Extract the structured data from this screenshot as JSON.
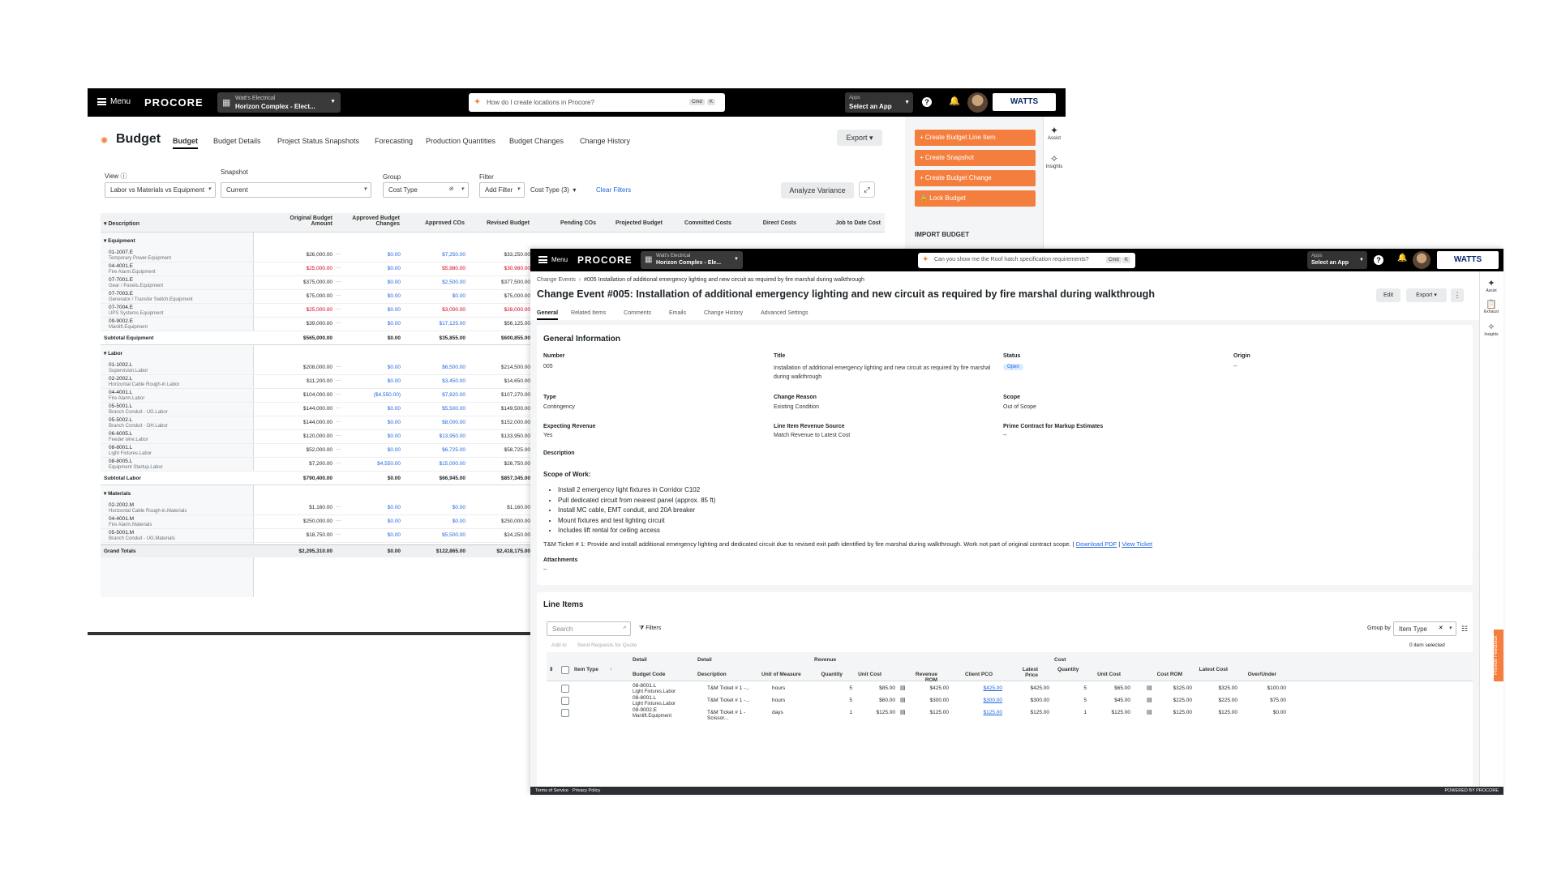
{
  "budget_window": {
    "topbar": {
      "menu_label": "Menu",
      "logo": "PROCORE",
      "project_company": "Watt's Electrical",
      "project_name": "Horizon Complex - Elect...",
      "search_placeholder": "How do I create locations in Procore?",
      "kbd_cmd": "Cmd",
      "kbd_k": "K",
      "apps_small": "Apps",
      "apps_main": "Select an App",
      "brand": "WATTS"
    },
    "page_title": "Budget",
    "tabs": [
      "Budget",
      "Budget Details",
      "Project Status Snapshots",
      "Forecasting",
      "Production Quantities",
      "Budget Changes",
      "Change History"
    ],
    "export_label": "Export",
    "view_label": "View",
    "view_value": "Labor vs Materials vs Equipment",
    "snapshot_label": "Snapshot",
    "snapshot_value": "Current",
    "group_label": "Group",
    "group_value": "Cost Type",
    "filter_label": "Filter",
    "filter_value": "Add Filter",
    "cost_type_filter": "Cost Type (3)",
    "clear_filters": "Clear Filters",
    "analyze_label": "Analyze Variance",
    "columns": [
      "Description",
      "Original Budget Amount",
      "Approved Budget Changes",
      "Approved COs",
      "Revised Budget",
      "Pending COs",
      "Projected Budget",
      "Committed Costs",
      "Direct Costs",
      "Job to Date Cost"
    ],
    "groups": [
      {
        "name": "Equipment",
        "rows": [
          {
            "code": "01-1007.E",
            "sub": "Temporary Power.Equipment",
            "orig": "$26,000.00",
            "abc": "$0.00",
            "aco": "$7,250.00",
            "rev": "$33,250.00",
            "neg": false
          },
          {
            "code": "04-4001.E",
            "sub": "Fire Alarm.Equipment",
            "orig": "$25,000.00",
            "abc": "$0.00",
            "aco": "$5,980.00",
            "rev": "$30,980.00",
            "neg": true
          },
          {
            "code": "07-7001.E",
            "sub": "Gear / Panels.Equipment",
            "orig": "$375,000.00",
            "abc": "$0.00",
            "aco": "$2,500.00",
            "rev": "$377,500.00",
            "neg": false
          },
          {
            "code": "07-7003.E",
            "sub": "Generator / Transfer Switch.Equipment",
            "orig": "$75,000.00",
            "abc": "$0.00",
            "aco": "$0.00",
            "rev": "$75,000.00",
            "neg": false
          },
          {
            "code": "07-7004.E",
            "sub": "UPS Systems.Equipment",
            "orig": "$25,000.00",
            "abc": "$0.00",
            "aco": "$3,000.00",
            "rev": "$28,000.00",
            "neg": true
          },
          {
            "code": "09-9002.E",
            "sub": "Manlift.Equipment",
            "orig": "$39,000.00",
            "abc": "$0.00",
            "aco": "$17,125.00",
            "rev": "$56,125.00",
            "neg": false
          }
        ],
        "subtotal": {
          "label": "Subtotal Equipment",
          "orig": "$565,000.00",
          "abc": "$0.00",
          "aco": "$35,855.00",
          "rev": "$600,855.00"
        }
      },
      {
        "name": "Labor",
        "rows": [
          {
            "code": "01-1002.L",
            "sub": "Supervision.Labor",
            "orig": "$208,000.00",
            "abc": "$0.00",
            "aco": "$6,500.00",
            "rev": "$214,500.00",
            "neg": false
          },
          {
            "code": "02-2002.L",
            "sub": "Horizontal Cable Rough-in.Labor",
            "orig": "$11,200.00",
            "abc": "$0.00",
            "aco": "$3,450.00",
            "rev": "$14,650.00",
            "neg": false
          },
          {
            "code": "04-4001.L",
            "sub": "Fire Alarm.Labor",
            "orig": "$104,000.00",
            "abc": "($4,550.00)",
            "aco": "$7,820.00",
            "rev": "$107,270.00",
            "neg": false
          },
          {
            "code": "05-5001.L",
            "sub": "Branch Conduit - UG.Labor",
            "orig": "$144,000.00",
            "abc": "$0.00",
            "aco": "$5,500.00",
            "rev": "$149,500.00",
            "neg": false
          },
          {
            "code": "05-5002.L",
            "sub": "Branch Conduit - OH.Labor",
            "orig": "$144,000.00",
            "abc": "$0.00",
            "aco": "$8,000.00",
            "rev": "$152,000.00",
            "neg": false
          },
          {
            "code": "06-6005.L",
            "sub": "Feeder wire.Labor",
            "orig": "$120,000.00",
            "abc": "$0.00",
            "aco": "$13,950.00",
            "rev": "$133,950.00",
            "neg": false
          },
          {
            "code": "08-8001.L",
            "sub": "Light Fixtures.Labor",
            "orig": "$52,000.00",
            "abc": "$0.00",
            "aco": "$6,725.00",
            "rev": "$58,725.00",
            "neg": false
          },
          {
            "code": "08-8005.L",
            "sub": "Equipment Startup.Labor",
            "orig": "$7,200.00",
            "abc": "$4,550.00",
            "aco": "$15,000.00",
            "rev": "$26,750.00",
            "neg": false
          }
        ],
        "subtotal": {
          "label": "Subtotal Labor",
          "orig": "$790,400.00",
          "abc": "$0.00",
          "aco": "$66,945.00",
          "rev": "$857,345.00"
        }
      },
      {
        "name": "Materials",
        "rows": [
          {
            "code": "02-2002.M",
            "sub": "Horizontal Cable Rough-in.Materials",
            "orig": "$1,160.00",
            "abc": "$0.00",
            "aco": "$0.00",
            "rev": "$1,160.00",
            "neg": false
          },
          {
            "code": "04-4001.M",
            "sub": "Fire Alarm.Materials",
            "orig": "$250,000.00",
            "abc": "$0.00",
            "aco": "$0.00",
            "rev": "$250,000.00",
            "neg": false
          },
          {
            "code": "05-5001.M",
            "sub": "Branch Conduit - UG.Materials",
            "orig": "$18,750.00",
            "abc": "$0.00",
            "aco": "$5,500.00",
            "rev": "$24,250.00",
            "neg": false
          }
        ]
      }
    ],
    "grand_totals": {
      "label": "Grand Totals",
      "orig": "$2,295,310.00",
      "abc": "$0.00",
      "aco": "$122,865.00",
      "rev": "$2,418,175.00"
    },
    "actions": [
      "Create Budget Line Item",
      "Create Snapshot",
      "Create Budget Change",
      "Lock Budget"
    ],
    "import_budget": "IMPORT BUDGET",
    "side_assist": "Assist",
    "side_insights": "Insights"
  },
  "change_event_window": {
    "topbar": {
      "menu_label": "Menu",
      "logo": "PROCORE",
      "project_company": "Watt's Electrical",
      "project_name": "Horizon Complex - Ele...",
      "search_placeholder": "Can you show me the Roof hatch specification requirements?",
      "kbd_cmd": "Cmd",
      "kbd_k": "K",
      "apps_small": "Apps",
      "apps_main": "Select an App",
      "brand": "WATTS"
    },
    "breadcrumb_root": "Change Events",
    "breadcrumb_current": "#005 Installation of additional emergency lighting and new circuit as required by fire marshal during walkthrough",
    "title": "Change Event #005: Installation of additional emergency lighting and new circuit as required by fire marshal during walkthrough",
    "edit_label": "Edit",
    "export_label": "Export",
    "tabs": [
      "General",
      "Related Items",
      "Comments",
      "Emails",
      "Change History",
      "Advanced Settings"
    ],
    "general_heading": "General Information",
    "fields": {
      "number_label": "Number",
      "number": "005",
      "title_label": "Title",
      "title": "Installation of additional emergency lighting and new circuit as required by fire marshal during walkthrough",
      "status_label": "Status",
      "status": "Open",
      "origin_label": "Origin",
      "origin": "--",
      "type_label": "Type",
      "type": "Contingency",
      "reason_label": "Change Reason",
      "reason": "Existing Condition",
      "scope_label": "Scope",
      "scope": "Out of Scope",
      "exp_rev_label": "Expecting Revenue",
      "exp_rev": "Yes",
      "rev_source_label": "Line Item Revenue Source",
      "rev_source": "Match Revenue to Latest Cost",
      "prime_label": "Prime Contract for Markup Estimates",
      "prime": "--",
      "description_label": "Description",
      "sow_heading": "Scope of Work:",
      "sow_items": [
        "Install 2 emergency light fixtures in Corridor C102",
        "Pull dedicated circuit from nearest panel (approx. 85 ft)",
        "Install MC cable, EMT conduit, and 20A breaker",
        "Mount fixtures and test lighting circuit",
        "Includes lift rental for ceiling access"
      ],
      "ticket_text": "T&M Ticket # 1: Provide and install additional emergency lighting and dedicated circuit due to revised exit path identified by fire marshal during walkthrough. Work not part of original contract scope. |",
      "download_pdf": "Download PDF",
      "view_ticket": "View Ticket",
      "attachments_label": "Attachments",
      "attachments": "--"
    },
    "line_items": {
      "heading": "Line Items",
      "search_placeholder": "Search",
      "filters_label": "Filters",
      "group_by_label": "Group by",
      "group_by_value": "Item Type",
      "add_to": "Add to",
      "send_rfq": "Send Requests for Quote",
      "selected": "0 item selected",
      "group_headers": [
        "Detail",
        "Detail",
        "Revenue",
        "Cost"
      ],
      "columns": [
        "Item Type",
        "Budget Code",
        "Description",
        "Unit of Measure",
        "Quantity",
        "Unit Cost",
        "Revenue ROM",
        "Client PCO",
        "Latest Price",
        "Quantity",
        "Unit Cost",
        "Cost ROM",
        "Latest Cost",
        "Over/Under"
      ],
      "rows": [
        {
          "code": "08-8001.L",
          "sub": "Light Fixtures.Labor",
          "desc": "T&M Ticket # 1 -...",
          "uom": "hours",
          "qty": "5",
          "ucost": "$85.00",
          "rrom": "$425.00",
          "pco": "$425.00",
          "lprice": "$425.00",
          "cqty": "5",
          "cucost": "$65.00",
          "crom": "$325.00",
          "lcost": "$325.00",
          "ou": "$100.00"
        },
        {
          "code": "08-8001.L",
          "sub": "Light Fixtures.Labor",
          "desc": "T&M Ticket # 1 -...",
          "uom": "hours",
          "qty": "5",
          "ucost": "$60.00",
          "rrom": "$300.00",
          "pco": "$300.00",
          "lprice": "$300.00",
          "cqty": "5",
          "cucost": "$45.00",
          "crom": "$225.00",
          "lcost": "$225.00",
          "ou": "$75.00"
        },
        {
          "code": "09-9002.E",
          "sub": "Manlift.Equipment",
          "desc": "T&M Ticket # 1 - Scissor...",
          "uom": "days",
          "qty": "1",
          "ucost": "$125.00",
          "rrom": "$125.00",
          "pco": "$125.00",
          "lprice": "$125.00",
          "cqty": "1",
          "cucost": "$125.00",
          "crom": "$125.00",
          "lcost": "$125.00",
          "ou": "$0.00"
        }
      ]
    },
    "footer_terms": "Terms of Service",
    "footer_privacy": "Privacy Policy",
    "footer_powered": "POWERED BY PROCORE",
    "feedback": "Provide Feedback",
    "side_assist": "Assist",
    "side_exhaust": "Exhaust",
    "side_insights": "Insights"
  },
  "colors": {
    "accent_orange": "#f47e3e",
    "link_blue": "#2066df",
    "negative_red": "#d0021b",
    "topbar": "#000000"
  }
}
